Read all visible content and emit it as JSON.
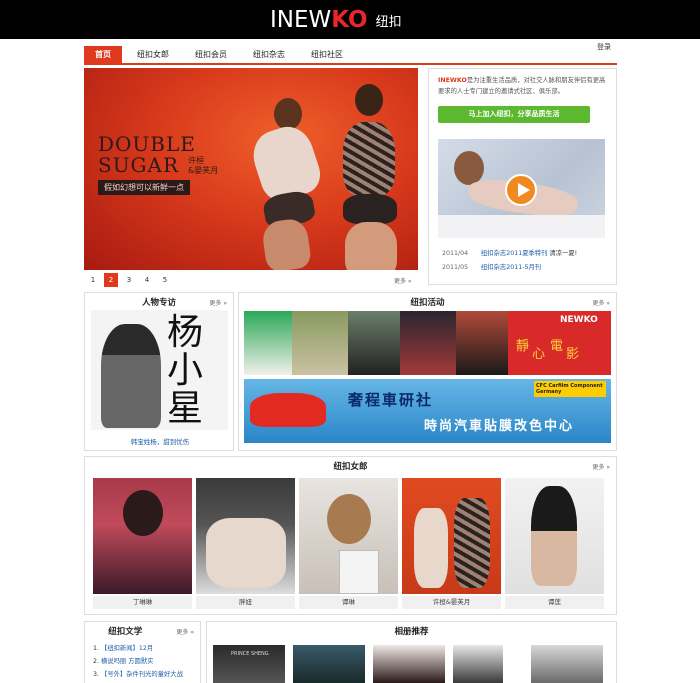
{
  "logo": {
    "part1": "INEW",
    "part2": "KO",
    "part3": "纽扣"
  },
  "nav": {
    "items": [
      "首页",
      "纽扣女郎",
      "纽扣会员",
      "纽扣杂志",
      "纽扣社区"
    ],
    "login": "登录"
  },
  "hero": {
    "line1": "DOUBLE",
    "line2": "SUGAR",
    "names_line1": "许桓",
    "names_line2": "&晏芙月",
    "tagline": "假如幻想可以新鲜一点"
  },
  "pager": {
    "pages": [
      "1",
      "2",
      "3",
      "4",
      "5"
    ],
    "active": "2",
    "more": "更多 »"
  },
  "side": {
    "brand": "INEWKO",
    "intro": "是为注重生活品质，对社交人脉和朋友伴侣有更高要求的人士专门建立的邀请式社区、俱乐部。",
    "join_button": "马上加入纽扣，分享品质生活",
    "list": [
      {
        "date": "2011/04",
        "title": "纽扣杂志2011夏季特刊",
        "extra": "清凉一夏!"
      },
      {
        "date": "2011/05",
        "title": "纽扣杂志2011-5月刊",
        "extra": ""
      }
    ]
  },
  "profile": {
    "title": "人物专访",
    "more": "更多 »",
    "caption": "韩宝姓杨，甜到忧伤",
    "art_text": "杨小星"
  },
  "activity": {
    "title": "纽扣活动",
    "more": "更多 »",
    "banner_title": "奢程車研社",
    "banner_sub": "時尚汽車貼膜改色中心",
    "banner_badge": "CFC Carfilm Component Germany",
    "strip_labels": [
      "靜",
      "心",
      "電",
      "影",
      "NEWKO"
    ]
  },
  "girls": {
    "title": "纽扣女郎",
    "more": "更多 »",
    "items": [
      "丁琳琳",
      "胖妞",
      "谭琳",
      "许桓&晏芙月",
      "谭莲"
    ]
  },
  "literature": {
    "title": "纽扣文学",
    "more": "更多 »",
    "items": [
      {
        "n": "1.",
        "text": "【纽扣新闻】12月"
      },
      {
        "n": "2.",
        "text": "横说吗丽 方圆默实"
      },
      {
        "n": "3.",
        "text": "【号外】杂件刊光的童好大战"
      }
    ]
  },
  "album": {
    "title": "相册推荐",
    "thumb_text": "PRINCE SHENG"
  },
  "colors": {
    "accent": "#e03a1e",
    "join": "#5cb82e",
    "link": "#1f5fa8"
  }
}
